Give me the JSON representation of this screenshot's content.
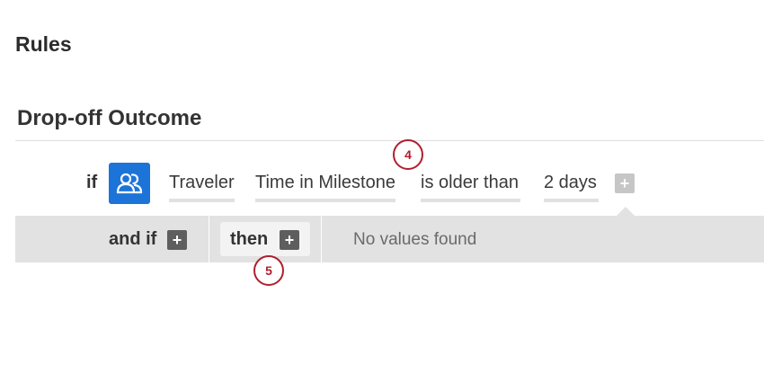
{
  "page": {
    "title": "Rules"
  },
  "rule": {
    "name": "Drop-off Outcome",
    "condition": {
      "if_label": "if",
      "context_icon": "users-icon",
      "context_color": "#1c74d9",
      "subject": "Traveler",
      "field": "Time in Milestone",
      "operator": "is older than",
      "value": "2 days",
      "add_icon": "plus-icon"
    },
    "actions": {
      "and_if_label": "and if",
      "then_label": "then",
      "empty_text": "No values found"
    }
  },
  "callouts": {
    "step_4": "4",
    "step_5": "5",
    "color": "#b01e2e"
  }
}
